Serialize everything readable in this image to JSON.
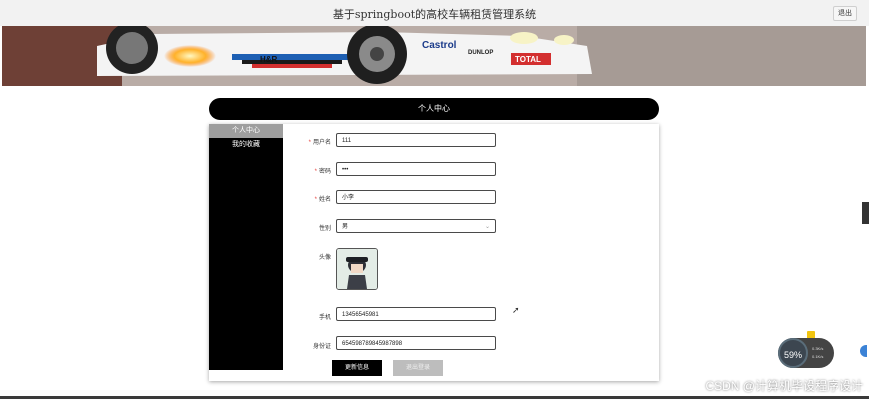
{
  "header": {
    "title": "基于springboot的高校车辆租赁管理系统",
    "logout_label": "退出"
  },
  "page": {
    "title": "个人中心"
  },
  "sidebar": {
    "items": [
      {
        "label": "个人中心",
        "active": true
      },
      {
        "label": "我的收藏",
        "active": false
      }
    ]
  },
  "form": {
    "username": {
      "label": "用户名",
      "value": "111",
      "required": true
    },
    "password": {
      "label": "密码",
      "value": "•••",
      "required": true
    },
    "name": {
      "label": "姓名",
      "value": "小李",
      "required": true
    },
    "gender": {
      "label": "性别",
      "value": "男"
    },
    "avatar": {
      "label": "头像"
    },
    "phone": {
      "label": "手机",
      "value": "13456545981"
    },
    "idcard": {
      "label": "身份证",
      "value": "654598789845987898"
    }
  },
  "buttons": {
    "update": "更新信息",
    "logout": "退出登录"
  },
  "widget": {
    "percent": "59%",
    "up": "0.3K/s",
    "down": "0.1K/s"
  },
  "watermark": "CSDN @计算机毕设程序设计",
  "colors": {
    "accent": "#000000",
    "sidebar_active": "#9e9e9e"
  }
}
